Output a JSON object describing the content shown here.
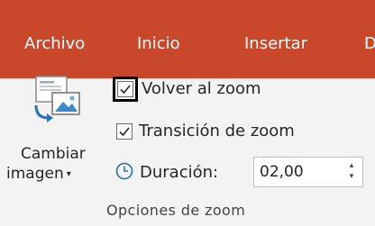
{
  "tabs": [
    {
      "label": "Archivo"
    },
    {
      "label": "Inicio"
    },
    {
      "label": "Insertar"
    },
    {
      "label": "D"
    }
  ],
  "group": {
    "label": "Opciones de zoom",
    "change_image": {
      "line1": "Cambiar",
      "line2": "imagen",
      "icon": "change-image-icon"
    },
    "return_to_zoom": {
      "label": "Volver al zoom",
      "checked": true
    },
    "zoom_transition": {
      "label": "Transición de zoom",
      "checked": true
    },
    "duration": {
      "label": "Duración:",
      "value": "02,00",
      "icon": "clock-icon"
    }
  },
  "colors": {
    "ribbon": "#c9482b",
    "body": "#f3f3f3",
    "icon_blue": "#2a71b6"
  }
}
